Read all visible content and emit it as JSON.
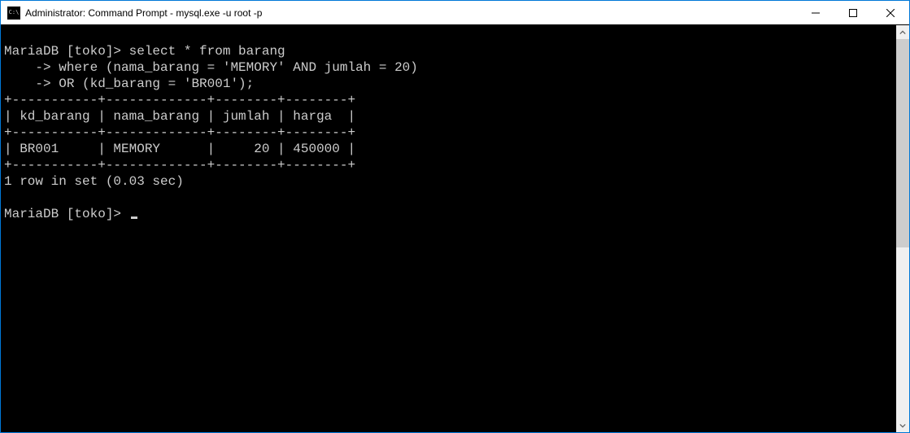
{
  "window": {
    "title": "Administrator: Command Prompt - mysql.exe  -u root -p",
    "icon_label": "C:\\"
  },
  "terminal": {
    "line_blank1": "",
    "prompt1": "MariaDB [toko]> select * from barang",
    "cont1": "    -> where (nama_barang = 'MEMORY' AND jumlah = 20)",
    "cont2": "    -> OR (kd_barang = 'BR001');",
    "sep": "+-----------+-------------+--------+--------+",
    "header": "| kd_barang | nama_barang | jumlah | harga  |",
    "row1": "| BR001     | MEMORY      |     20 | 450000 |",
    "result": "1 row in set (0.03 sec)",
    "line_blank2": "",
    "prompt2": "MariaDB [toko]> "
  },
  "chart_data": {
    "type": "table",
    "title": "select * from barang where (nama_barang = 'MEMORY' AND jumlah = 20) OR (kd_barang = 'BR001')",
    "columns": [
      "kd_barang",
      "nama_barang",
      "jumlah",
      "harga"
    ],
    "rows": [
      [
        "BR001",
        "MEMORY",
        20,
        450000
      ]
    ],
    "row_count": 1,
    "elapsed_sec": 0.03
  }
}
